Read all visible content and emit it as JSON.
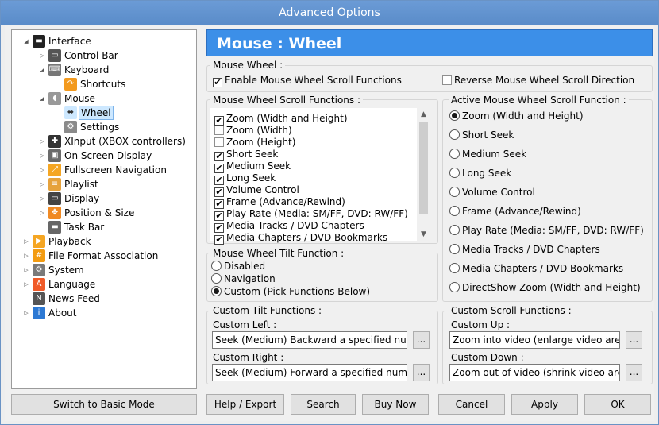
{
  "window": {
    "title": "Advanced Options"
  },
  "tree": {
    "items": [
      {
        "label": "Interface",
        "level": 0,
        "expanded": true,
        "icon": "monitor-icon"
      },
      {
        "label": "Control Bar",
        "level": 1,
        "expanded": false,
        "icon": "control-bar-icon"
      },
      {
        "label": "Keyboard",
        "level": 1,
        "expanded": true,
        "icon": "keyboard-icon"
      },
      {
        "label": "Shortcuts",
        "level": 2,
        "icon": "shortcut-arrow-icon"
      },
      {
        "label": "Mouse",
        "level": 1,
        "expanded": true,
        "icon": "mouse-icon"
      },
      {
        "label": "Wheel",
        "level": 2,
        "icon": "wheel-icon",
        "selected": true
      },
      {
        "label": "Settings",
        "level": 2,
        "icon": "gears-icon"
      },
      {
        "label": "XInput (XBOX controllers)",
        "level": 1,
        "expanded": false,
        "icon": "gamepad-icon"
      },
      {
        "label": "On Screen Display",
        "level": 1,
        "expanded": false,
        "icon": "osd-icon"
      },
      {
        "label": "Fullscreen Navigation",
        "level": 1,
        "expanded": false,
        "icon": "fullscreen-icon"
      },
      {
        "label": "Playlist",
        "level": 1,
        "expanded": false,
        "icon": "playlist-icon"
      },
      {
        "label": "Display",
        "level": 1,
        "expanded": false,
        "icon": "display-icon"
      },
      {
        "label": "Position & Size",
        "level": 1,
        "expanded": false,
        "icon": "position-icon"
      },
      {
        "label": "Task Bar",
        "level": 1,
        "icon": "taskbar-icon"
      },
      {
        "label": "Playback",
        "level": 0,
        "expanded": false,
        "icon": "playback-icon"
      },
      {
        "label": "File Format Association",
        "level": 0,
        "expanded": false,
        "icon": "file-association-icon"
      },
      {
        "label": "System",
        "level": 0,
        "expanded": false,
        "icon": "gear-icon"
      },
      {
        "label": "Language",
        "level": 0,
        "expanded": false,
        "icon": "language-icon"
      },
      {
        "label": "News Feed",
        "level": 0,
        "icon": "news-icon"
      },
      {
        "label": "About",
        "level": 0,
        "expanded": false,
        "icon": "info-icon"
      }
    ]
  },
  "header": {
    "title": "Mouse : Wheel"
  },
  "mouse_wheel": {
    "title": "Mouse Wheel :",
    "enable_label": "Enable Mouse Wheel Scroll Functions",
    "enable_checked": true,
    "reverse_label": "Reverse Mouse Wheel Scroll Direction",
    "reverse_checked": false
  },
  "scroll_functions": {
    "title": "Mouse Wheel Scroll Functions :",
    "items": [
      {
        "label": "Zoom (Width and Height)",
        "checked": true
      },
      {
        "label": "Zoom (Width)",
        "checked": false
      },
      {
        "label": "Zoom (Height)",
        "checked": false
      },
      {
        "label": "Short Seek",
        "checked": true
      },
      {
        "label": "Medium Seek",
        "checked": true
      },
      {
        "label": "Long Seek",
        "checked": true
      },
      {
        "label": "Volume Control",
        "checked": true
      },
      {
        "label": "Frame (Advance/Rewind)",
        "checked": true
      },
      {
        "label": "Play Rate (Media: SM/FF, DVD: RW/FF)",
        "checked": true
      },
      {
        "label": "Media Tracks / DVD Chapters",
        "checked": true
      },
      {
        "label": "Media Chapters / DVD Bookmarks",
        "checked": true
      }
    ]
  },
  "active_scroll": {
    "title": "Active Mouse Wheel Scroll Function :",
    "items": [
      {
        "label": "Zoom (Width and Height)",
        "selected": true
      },
      {
        "label": "Short Seek",
        "selected": false
      },
      {
        "label": "Medium Seek",
        "selected": false
      },
      {
        "label": "Long Seek",
        "selected": false
      },
      {
        "label": "Volume Control",
        "selected": false
      },
      {
        "label": "Frame (Advance/Rewind)",
        "selected": false
      },
      {
        "label": "Play Rate (Media: SM/FF, DVD: RW/FF)",
        "selected": false
      },
      {
        "label": "Media Tracks / DVD Chapters",
        "selected": false
      },
      {
        "label": "Media Chapters / DVD Bookmarks",
        "selected": false
      },
      {
        "label": "DirectShow Zoom (Width and Height)",
        "selected": false
      }
    ]
  },
  "tilt": {
    "title": "Mouse Wheel Tilt Function :",
    "items": [
      {
        "label": "Disabled",
        "selected": false
      },
      {
        "label": "Navigation",
        "selected": false
      },
      {
        "label": "Custom (Pick Functions Below)",
        "selected": true
      }
    ]
  },
  "custom_tilt": {
    "title": "Custom Tilt Functions :",
    "left_label": "Custom Left :",
    "left_value": "Seek (Medium) Backward a specified number",
    "right_label": "Custom Right :",
    "right_value": "Seek (Medium) Forward a specified number o"
  },
  "custom_scroll": {
    "title": "Custom Scroll Functions :",
    "up_label": "Custom Up :",
    "up_value": "Zoom into video (enlarge video area)",
    "down_label": "Custom Down :",
    "down_value": "Zoom out of video (shrink video area)"
  },
  "browse_label": "...",
  "buttons": {
    "basic_mode": "Switch to Basic Mode",
    "help": "Help / Export",
    "search": "Search",
    "buy": "Buy Now",
    "cancel": "Cancel",
    "apply": "Apply",
    "ok": "OK"
  },
  "colors": {
    "header_bg": "#3c8fe8",
    "selection": "#cde8ff",
    "title_bar": "#5f8fc4"
  }
}
